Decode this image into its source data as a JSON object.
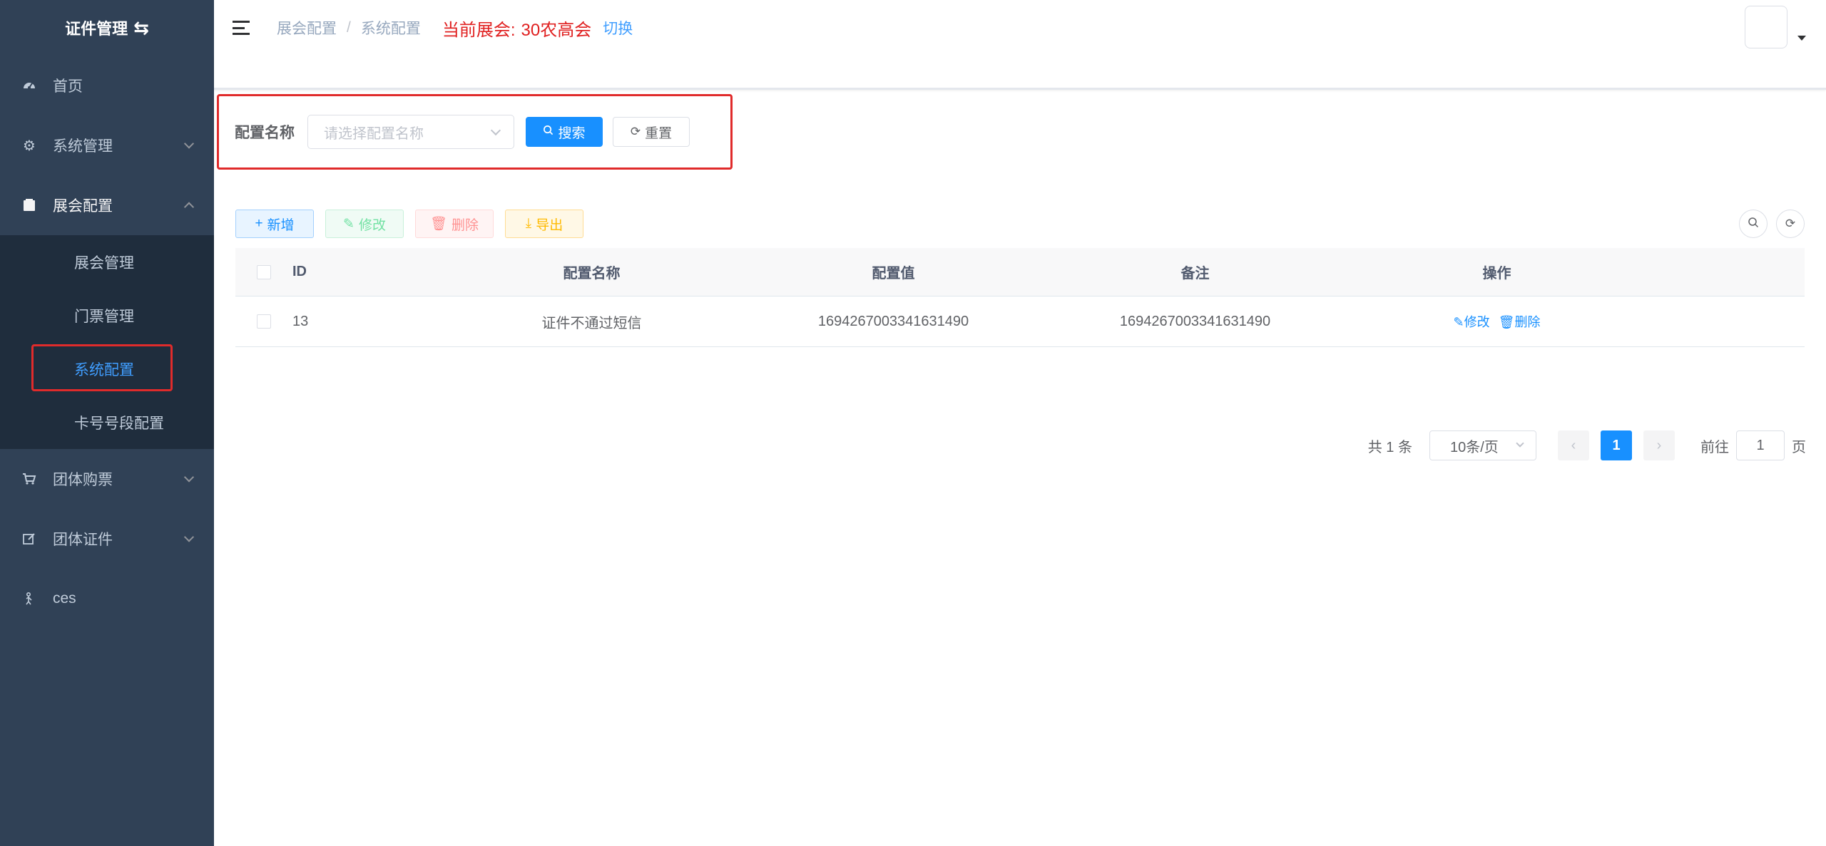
{
  "sidebar": {
    "logo_title": "证件管理",
    "logo_icon": "swap-icon",
    "items": [
      {
        "label": "首页",
        "icon": "dashboard-icon"
      },
      {
        "label": "系统管理",
        "icon": "gear-icon"
      },
      {
        "label": "展会配置",
        "icon": "folder-icon"
      },
      {
        "label": "团体购票",
        "icon": "cart-icon"
      },
      {
        "label": "团体证件",
        "icon": "edit-icon"
      },
      {
        "label": "ces",
        "icon": "hand-icon"
      }
    ],
    "submenu": [
      "展会管理",
      "门票管理",
      "系统配置",
      "卡号号段配置"
    ]
  },
  "header": {
    "breadcrumb": [
      "展会配置",
      "系统配置"
    ],
    "breadcrumb_sep": "/",
    "current_expo_label": "当前展会:",
    "current_expo_name": "30农高会",
    "switch_label": "切换"
  },
  "search": {
    "label": "配置名称",
    "placeholder": "请选择配置名称",
    "search_button": "搜索",
    "reset_button": "重置"
  },
  "toolbar": {
    "add": "新增",
    "edit": "修改",
    "delete": "删除",
    "export": "导出"
  },
  "table": {
    "columns": [
      "ID",
      "配置名称",
      "配置值",
      "备注",
      "操作"
    ],
    "rows": [
      {
        "id": "13",
        "name": "证件不通过短信",
        "value": "1694267003341631490",
        "remark": "1694267003341631490",
        "edit": "修改",
        "delete": "删除"
      }
    ]
  },
  "pagination": {
    "total": "共 1 条",
    "page_size": "10条/页",
    "current_page": "1",
    "goto_label": "前往",
    "goto_value": "1",
    "page_suffix": "页"
  },
  "colors": {
    "sidebar_bg": "#304156",
    "submenu_bg": "#1f2d3d",
    "primary": "#1890ff",
    "highlight_border": "#e02b2b",
    "expo_text": "#e02020"
  }
}
